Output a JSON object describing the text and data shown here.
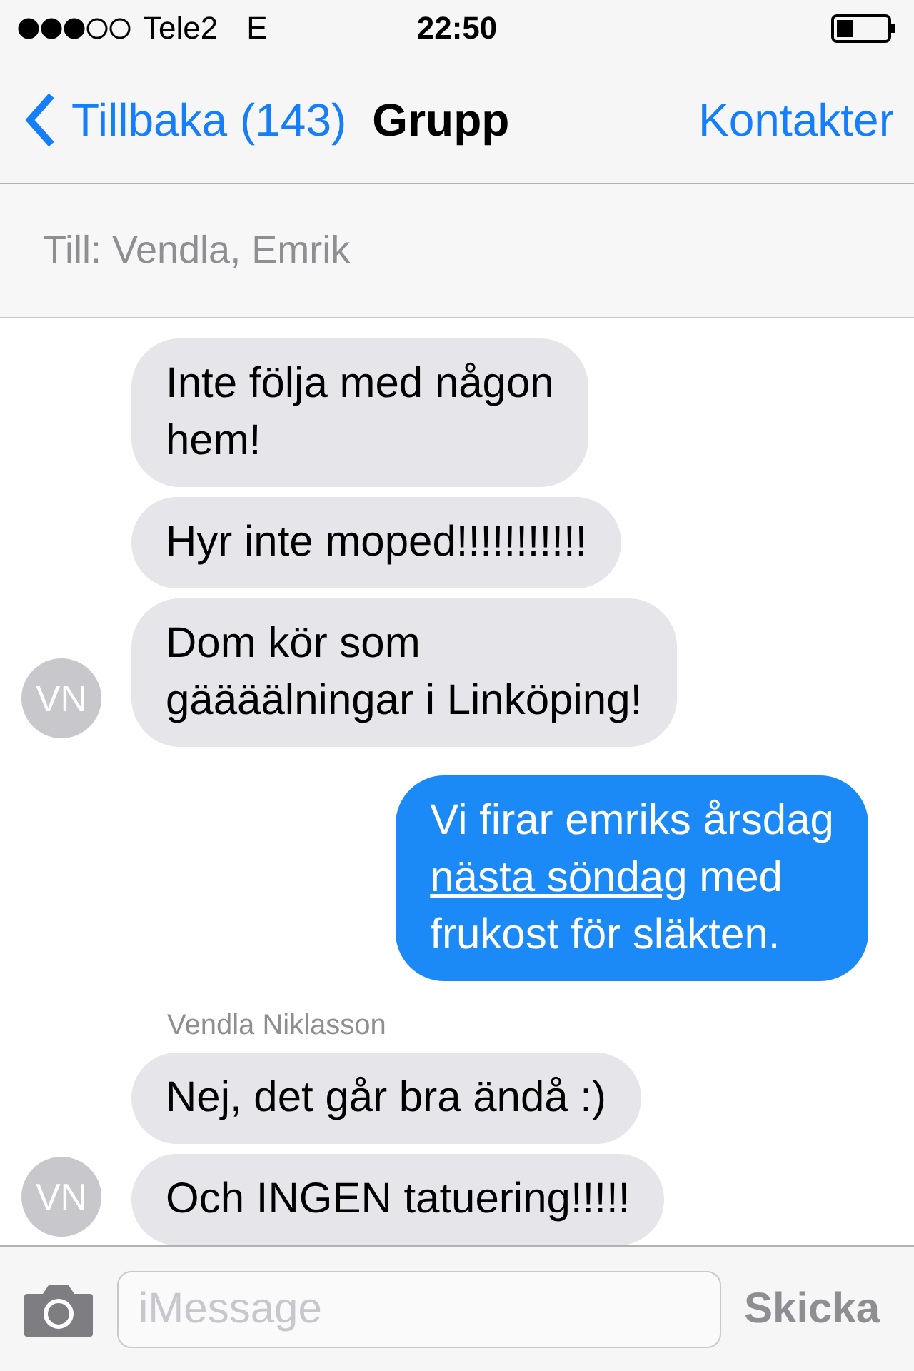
{
  "status_bar": {
    "carrier": "Tele2",
    "network": "E",
    "time": "22:50"
  },
  "nav_bar": {
    "back": "Tillbaka (143)",
    "title": "Grupp",
    "action": "Kontakter"
  },
  "recipients": "Till: Vendla, Emrik",
  "messages": [
    {
      "kind": "incoming",
      "lines": [
        "Inte följa med någon",
        "hem!"
      ]
    },
    {
      "kind": "incoming",
      "lines": [
        "Hyr inte moped!!!!!!!!!!!"
      ]
    },
    {
      "kind": "incoming",
      "lines": [
        "Dom kör som",
        "gäääälningar i Linköping!"
      ],
      "avatar": "VN"
    },
    {
      "kind": "outgoing",
      "lines": [
        [
          {
            "kind": "text",
            "text": "Vi firar emriks årsdag"
          }
        ],
        [
          {
            "kind": "link",
            "text": "nästa söndag"
          },
          {
            "kind": "text",
            "text": " med"
          }
        ],
        [
          {
            "kind": "text",
            "text": "frukost för släkten."
          }
        ]
      ]
    },
    {
      "kind": "sender",
      "name": "Vendla Niklasson"
    },
    {
      "kind": "incoming",
      "lines": [
        "Nej, det går bra ändå :)"
      ]
    },
    {
      "kind": "incoming",
      "lines": [
        "Och INGEN tatuering!!!!!"
      ],
      "avatar": "VN"
    }
  ],
  "input_bar": {
    "placeholder": "iMessage",
    "send": "Skicka"
  }
}
